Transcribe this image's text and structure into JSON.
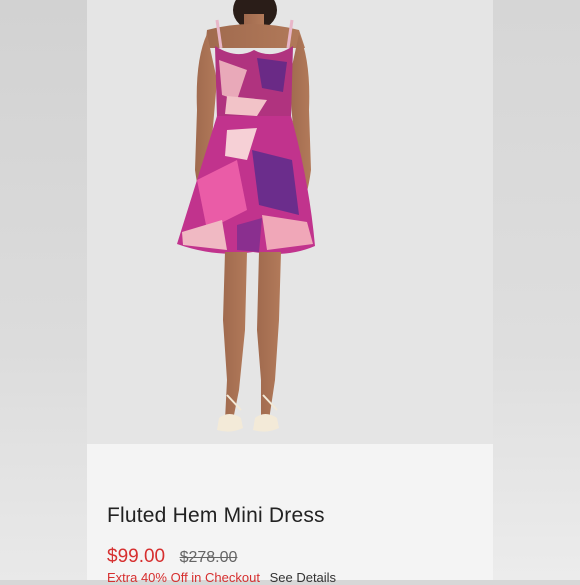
{
  "product": {
    "title": "Fluted Hem Mini Dress",
    "sale_price": "$99.00",
    "original_price": "$278.00",
    "promo_text": "Extra 40% Off in Checkout",
    "details_link": "See Details"
  },
  "colors": {
    "sale": "#d62f2f",
    "image_background": "#e5e5e5",
    "panel_background": "#f4f4f4"
  }
}
